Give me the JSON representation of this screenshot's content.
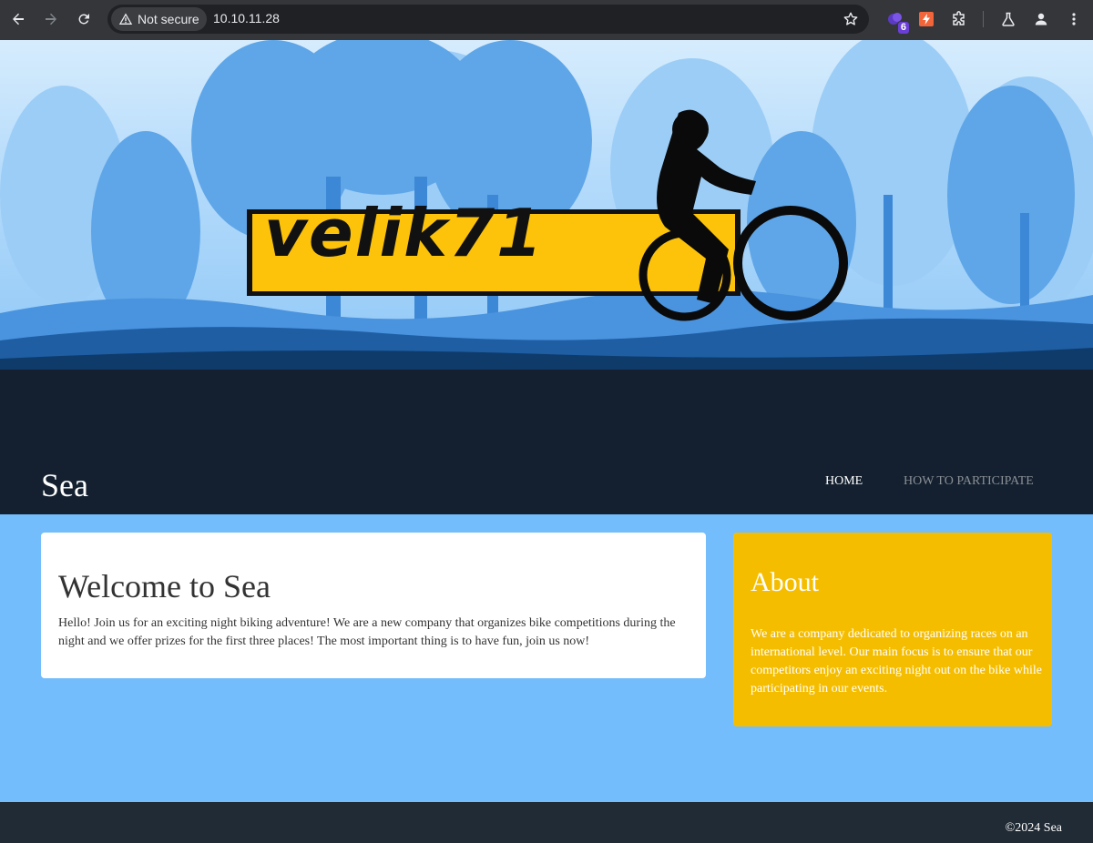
{
  "browser": {
    "security_label": "Not secure",
    "url": "10.10.11.28",
    "extension_badge": "6",
    "icons": [
      "back-icon",
      "forward-icon",
      "reload-icon",
      "warning-icon",
      "star-icon",
      "extension-icon",
      "lightning-icon",
      "puzzle-icon",
      "labs-icon",
      "profile-icon",
      "menu-icon"
    ]
  },
  "banner": {
    "logo_text": "velik71"
  },
  "site": {
    "title": "Sea",
    "nav": {
      "home": "HOME",
      "participate": "HOW TO PARTICIPATE"
    }
  },
  "welcome": {
    "heading": "Welcome to Sea",
    "text": "Hello! Join us for an exciting night biking adventure! We are a new company that organizes bike competitions during the night and we offer prizes for the first three places! The most important thing is to have fun, join us now!"
  },
  "about": {
    "heading": "About",
    "text": "We are a company dedicated to organizing races on an international level. Our main focus is to ensure that our competitors enjoy an exciting night out on the bike while participating in our events."
  },
  "footer": {
    "copyright": "©2024 Sea"
  },
  "colors": {
    "page_background": "#74bdfc",
    "header_dark": "#14202f",
    "about_card": "#f5bd00",
    "footer": "#212b35",
    "logo_yellow": "#fcc30a"
  }
}
